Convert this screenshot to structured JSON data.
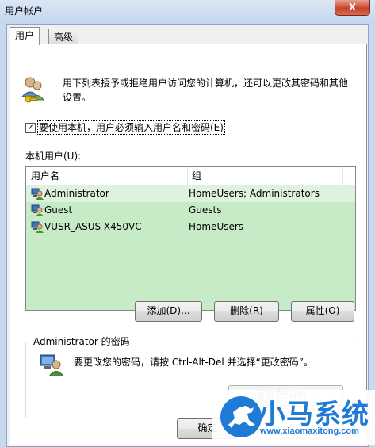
{
  "window": {
    "title": "用户帐户",
    "close_glyph": "X"
  },
  "tabs": [
    {
      "label": "用户",
      "active": true
    },
    {
      "label": "高级",
      "active": false
    }
  ],
  "intro": {
    "text": "用下列表授予或拒绝用户访问您的计算机，还可以更改其密码和其他设置。"
  },
  "require_login": {
    "checked": true,
    "check_glyph": "✓",
    "label": "要使用本机，用户必须输入用户名和密码(E)"
  },
  "users_list": {
    "label": "本机用户(U):",
    "columns": [
      "用户名",
      "组"
    ],
    "rows": [
      {
        "name": "Administrator",
        "group": "HomeUsers; Administrators"
      },
      {
        "name": "Guest",
        "group": "Guests"
      },
      {
        "name": "VUSR_ASUS-X450VC",
        "group": "HomeUsers"
      }
    ]
  },
  "buttons": {
    "add": "添加(D)...",
    "remove": "删除(R)",
    "properties": "属性(O)"
  },
  "password_group": {
    "title": "Administrator 的密码",
    "text": "要更改您的密码，请按 Ctrl-Alt-Del 并选择“更改密码”。",
    "reset_button": "重置密码(P)..."
  },
  "footer": {
    "ok_button": "确定"
  },
  "watermark": {
    "brand": "小马系统",
    "url": "www.xiaomaxitong.com"
  },
  "colors": {
    "accent": "#1f7bd6",
    "list_bg": "#c8ebc7",
    "title_bg": "#c6d9ef",
    "close": "#c7432c"
  }
}
